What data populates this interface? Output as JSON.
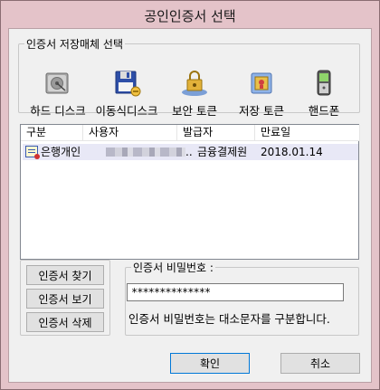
{
  "window": {
    "title": "공인인증서 선택"
  },
  "storage": {
    "legend": "인증서 저장매체 선택",
    "items": [
      {
        "label": "하드 디스크",
        "icon": "hard-disk-icon"
      },
      {
        "label": "이동식디스크",
        "icon": "removable-disk-icon"
      },
      {
        "label": "보안 토큰",
        "icon": "security-token-icon"
      },
      {
        "label": "저장 토큰",
        "icon": "storage-token-icon"
      },
      {
        "label": "핸드폰",
        "icon": "mobile-phone-icon"
      }
    ]
  },
  "cert_list": {
    "columns": [
      "구분",
      "사용자",
      "발급자",
      "만료일"
    ],
    "rows": [
      {
        "type": "은행개인",
        "user_suffix": "..",
        "issuer": "금융결제원",
        "expiry": "2018.01.14"
      }
    ]
  },
  "actions": {
    "find": "인증서 찾기",
    "view": "인증서 보기",
    "delete": "인증서 삭제"
  },
  "password": {
    "legend": "인증서 비밀번호 :",
    "value": "**************",
    "hint": "인증서 비밀번호는 대소문자를 구분합니다."
  },
  "footer": {
    "ok": "확인",
    "cancel": "취소"
  },
  "colors": {
    "frame": "#e4c3c9",
    "selection": "#e8e8f6",
    "focus": "#0078d7"
  }
}
